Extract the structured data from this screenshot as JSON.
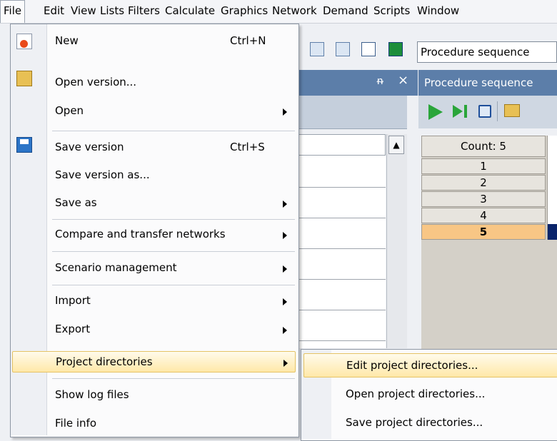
{
  "menubar": {
    "items": [
      "File",
      "Edit",
      "View",
      "Lists",
      "Filters",
      "Calculate",
      "Graphics",
      "Network",
      "Demand",
      "Scripts",
      "Window"
    ]
  },
  "toolbar": {
    "procedure_combo_value": "Procedure sequence"
  },
  "left_pane": {
    "close_glyph": "×",
    "pin_glyph": "ᵰ"
  },
  "procedure_pane": {
    "title": "Procedure sequence",
    "count_header": "Count: 5",
    "rows": [
      "1",
      "2",
      "3",
      "4",
      "5"
    ],
    "selected_row": "5"
  },
  "file_menu": {
    "items": [
      {
        "label": "New",
        "shortcut": "Ctrl+N"
      },
      {
        "label": "Open version..."
      },
      {
        "label": "Open"
      },
      {
        "label": "Save version",
        "shortcut": "Ctrl+S"
      },
      {
        "label": "Save version as..."
      },
      {
        "label": "Save as"
      },
      {
        "label": "Compare and transfer networks"
      },
      {
        "label": "Scenario management"
      },
      {
        "label": "Import"
      },
      {
        "label": "Export"
      },
      {
        "label": "Project directories"
      },
      {
        "label": "Show log files"
      },
      {
        "label": "File info"
      }
    ],
    "highlighted": "Project directories"
  },
  "submenu": {
    "items": [
      {
        "label": "Edit project directories..."
      },
      {
        "label": "Open project directories..."
      },
      {
        "label": "Save project directories..."
      }
    ],
    "highlighted": "Edit project directories..."
  },
  "colors": {
    "pane_title": "#5c7ea9",
    "highlight": "#ffe8a8",
    "selected_cell": "#f8c685"
  }
}
